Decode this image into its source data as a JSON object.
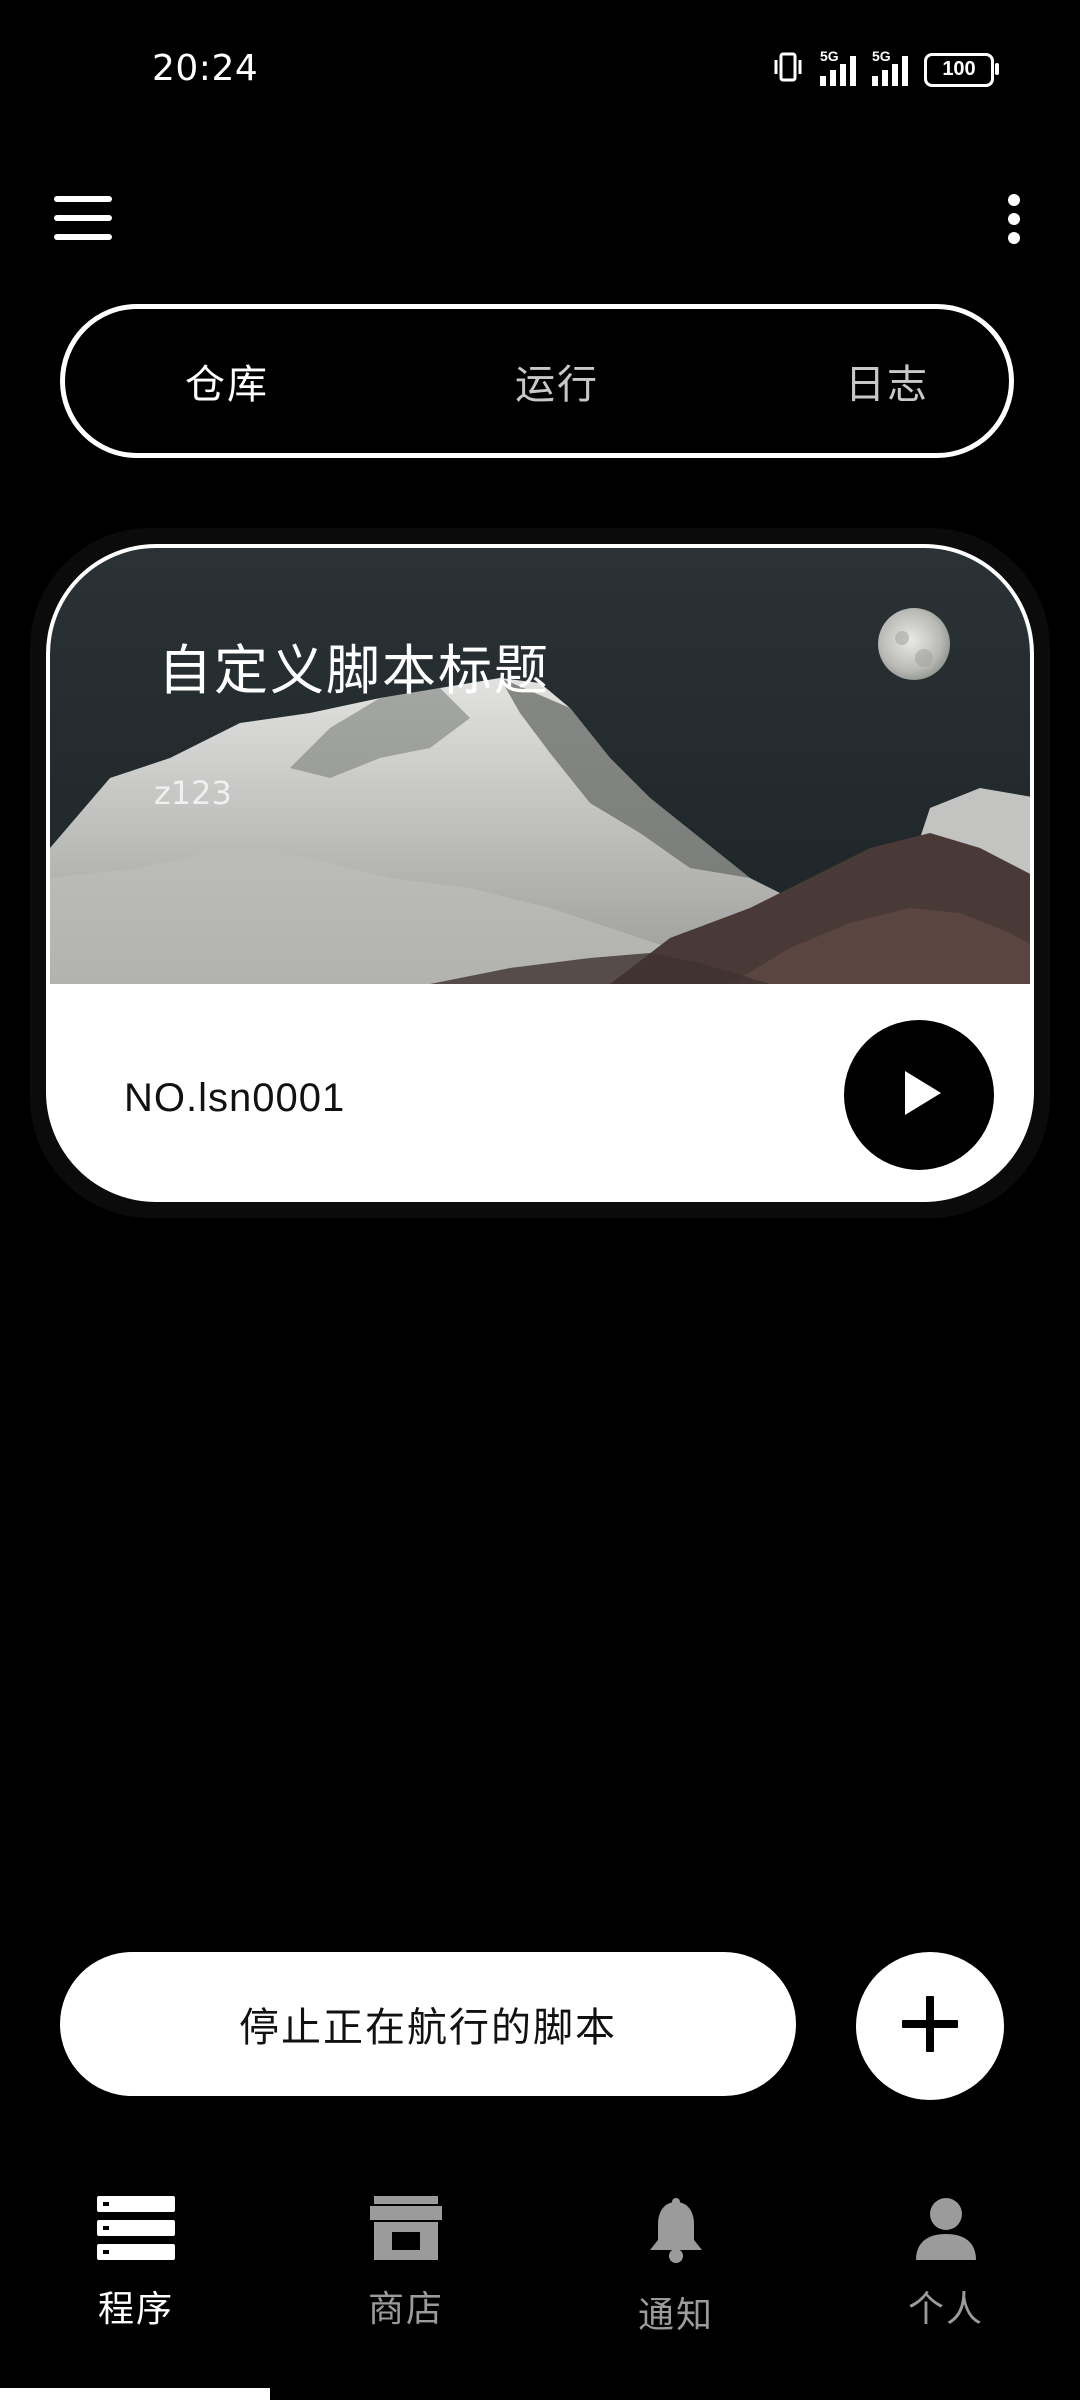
{
  "status_bar": {
    "time": "20:24",
    "network_1": "5G",
    "network_2": "5G",
    "battery": "100",
    "icons": [
      "vibrate-icon",
      "signal-5g-icon",
      "signal-5g-icon",
      "battery-icon"
    ]
  },
  "header": {
    "menu_icon": "menu-icon",
    "more_icon": "more-vertical-icon"
  },
  "tabs": [
    {
      "label": "仓库",
      "active": true
    },
    {
      "label": "运行",
      "active": false
    },
    {
      "label": "日志",
      "active": false
    }
  ],
  "script_card": {
    "title": "自定义脚本标题",
    "subtitle": "z123",
    "number": "NO.lsn0001",
    "play_icon": "play-icon"
  },
  "actions": {
    "stop_label": "停止正在航行的脚本",
    "add_icon": "plus-icon"
  },
  "bottom_nav": [
    {
      "label": "程序",
      "icon": "list-icon",
      "active": true
    },
    {
      "label": "商店",
      "icon": "store-icon",
      "active": false
    },
    {
      "label": "通知",
      "icon": "bell-icon",
      "active": false
    },
    {
      "label": "个人",
      "icon": "person-icon",
      "active": false
    }
  ],
  "colors": {
    "background": "#000000",
    "surface": "#ffffff",
    "inactive": "#9b9b9b"
  }
}
